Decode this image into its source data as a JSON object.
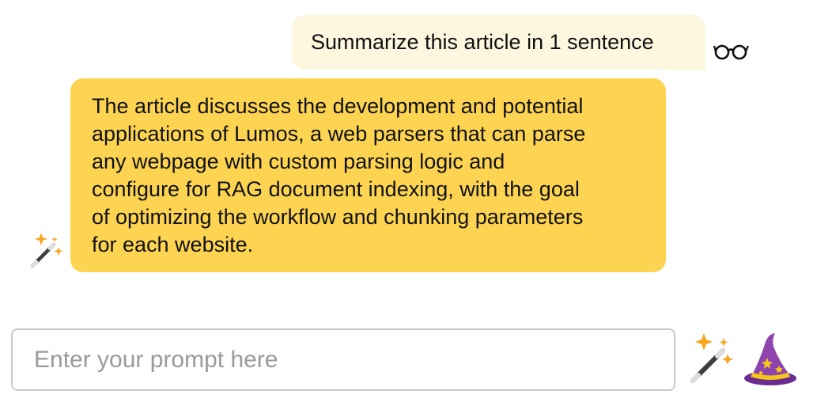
{
  "conversation": {
    "user_message": {
      "text": "Summarize this article in 1 sentence",
      "avatar_icon": "glasses-icon"
    },
    "assistant_message": {
      "lines": [
        "The article discusses the development and potential",
        "applications of Lumos, a web parsers that can parse",
        "any webpage with custom parsing logic and",
        "configure for RAG document indexing, with the goal",
        "of optimizing the workflow and chunking parameters",
        "for each website."
      ],
      "avatar_icon": "magic-wand-icon"
    }
  },
  "composer": {
    "placeholder": "Enter your prompt here",
    "value": "",
    "submit_icon": "magic-wand-icon",
    "assistant_icon": "wizard-hat-icon"
  },
  "colors": {
    "user_bubble": "#fdf7df",
    "assistant_bubble": "#fdd451",
    "input_border": "#c9c9c9",
    "placeholder_text": "#9a9a9a"
  }
}
